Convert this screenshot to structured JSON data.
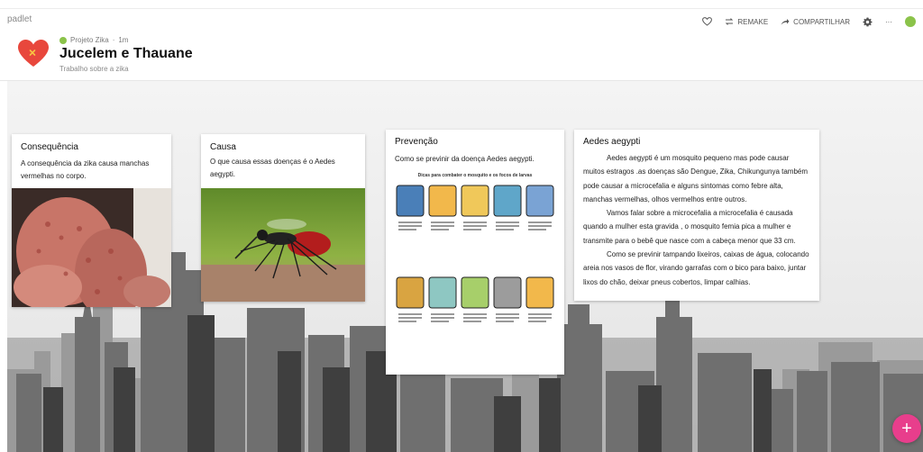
{
  "app": {
    "brand": "padlet"
  },
  "header": {
    "breadcrumb": "Projeto Zika",
    "time": "1m",
    "title": "Jucelem e Thauane",
    "subtitle": "Trabalho sobre a zika",
    "actions": {
      "remake": "REMAKE",
      "share": "COMPARTILHAR",
      "more": "···"
    }
  },
  "colors": {
    "heart": "#e8473c",
    "accent_green": "#8bc34a",
    "fab": "#e83e8c"
  },
  "posts": [
    {
      "title": "Consequência",
      "body": "A consequência da zika causa manchas vermelhas no corpo.",
      "attachment": "skin-rash-photo"
    },
    {
      "title": "Causa",
      "body": "O que causa essas doenças é o Aedes aegypti.",
      "attachment": "mosquito-photo"
    },
    {
      "title": "Prevenção",
      "body": "Como se previnir da doença Aedes aegypti.",
      "attachment": "prevention-poster",
      "poster_title": "Dicas para combater o mosquito e os focos de larvas"
    },
    {
      "title": "Aedes aegypti",
      "paragraphs": [
        "Aedes aegypti  é um mosquito pequeno mas pode causar muitos estragos .as doenças são Dengue, Zika, Chikungunya também pode causar a microcefalia e alguns sintomas como febre alta, manchas vermelhas, olhos vermelhos entre outros.",
        "Vamos falar sobre a microcefalia a microcefalia é  causada quando a mulher esta gravida , o mosquito  femia pica a mulher e transmite para o bebê que nasce com a cabeça menor que 33 cm.",
        "Como se previnir  tampando lixeiros, caixas de água, colocando areia nos vasos de flor, virando garrafas com o bico para baixo, juntar lixos do chão, deixar pneus  cobertos, limpar calhias."
      ]
    }
  ],
  "fab": {
    "label": "+"
  }
}
